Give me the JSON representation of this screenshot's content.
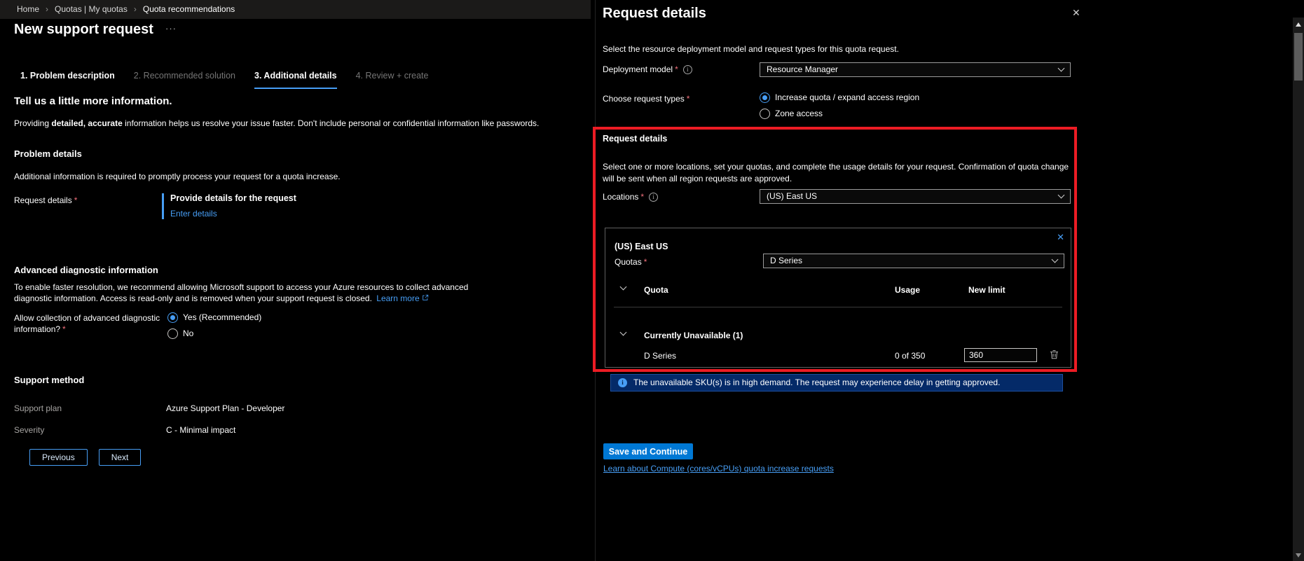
{
  "required_mark": "*",
  "icons": {
    "info": "i",
    "close": "✕",
    "more": "···"
  },
  "colors": {
    "accent": "#0078d4",
    "link": "#479ef5",
    "annotation_red": "#ec1c24",
    "required": "#f1707b",
    "banner_bg": "#042a68"
  },
  "breadcrumb": {
    "separator": "›",
    "items": [
      "Home",
      "Quotas | My quotas",
      "Quota recommendations"
    ]
  },
  "page": {
    "title": "New support request"
  },
  "steps": [
    {
      "label": "1. Problem description",
      "state": "enabled"
    },
    {
      "label": "2. Recommended solution",
      "state": "disabled"
    },
    {
      "label": "3. Additional details",
      "state": "active"
    },
    {
      "label": "4. Review + create",
      "state": "disabled"
    }
  ],
  "main": {
    "heading": "Tell us a little more information.",
    "intro": {
      "pre": "Providing ",
      "bold": "detailed, accurate",
      "post": " information helps us resolve your issue faster. Don't include personal or confidential information like passwords."
    },
    "problem": {
      "heading": "Problem details",
      "description": "Additional information is required to promptly process your request for a quota increase.",
      "field_label": "Request details",
      "provide_title": "Provide details for the request",
      "enter_link": "Enter details"
    },
    "advanced": {
      "heading": "Advanced diagnostic information",
      "description": "To enable faster resolution, we recommend allowing Microsoft support to access your Azure resources to collect advanced diagnostic information. Access is read-only and is removed when your support request is closed.",
      "learn_more": "Learn more",
      "allow_label": "Allow collection of advanced diagnostic information?",
      "options": [
        {
          "label": "Yes (Recommended)",
          "selected": true
        },
        {
          "label": "No",
          "selected": false
        }
      ]
    },
    "support_method": {
      "heading": "Support method",
      "plan_label": "Support plan",
      "plan_value": "Azure Support Plan - Developer",
      "severity_label": "Severity",
      "severity_value": "C - Minimal impact"
    },
    "previous_button": "Previous",
    "next_button": "Next"
  },
  "panel": {
    "title": "Request details",
    "intro": "Select the resource deployment model and request types for this quota request.",
    "deployment_label": "Deployment model",
    "deployment_value": "Resource Manager",
    "request_types_label": "Choose request types",
    "request_types": [
      {
        "label": "Increase quota / expand access region",
        "selected": true
      },
      {
        "label": "Zone access",
        "selected": false
      }
    ],
    "section": {
      "heading": "Request details",
      "description": "Select one or more locations, set your quotas, and complete the usage details for your request. Confirmation of quota change will be sent when all region requests are approved.",
      "locations_label": "Locations",
      "locations_value": "(US) East US",
      "card": {
        "region": "(US) East US",
        "quotas_label": "Quotas",
        "quotas_value": "D Series",
        "columns": {
          "quota": "Quota",
          "usage": "Usage",
          "new_limit": "New limit"
        },
        "group_label": "Currently Unavailable (1)",
        "rows": [
          {
            "name": "D Series",
            "usage": "0 of 350",
            "new_limit": "360"
          }
        ]
      },
      "banner": "The unavailable SKU(s) is in high demand. The request may experience delay in getting approved."
    },
    "save_button": "Save and Continue",
    "learn_link": "Learn about Compute (cores/vCPUs) quota increase requests"
  }
}
